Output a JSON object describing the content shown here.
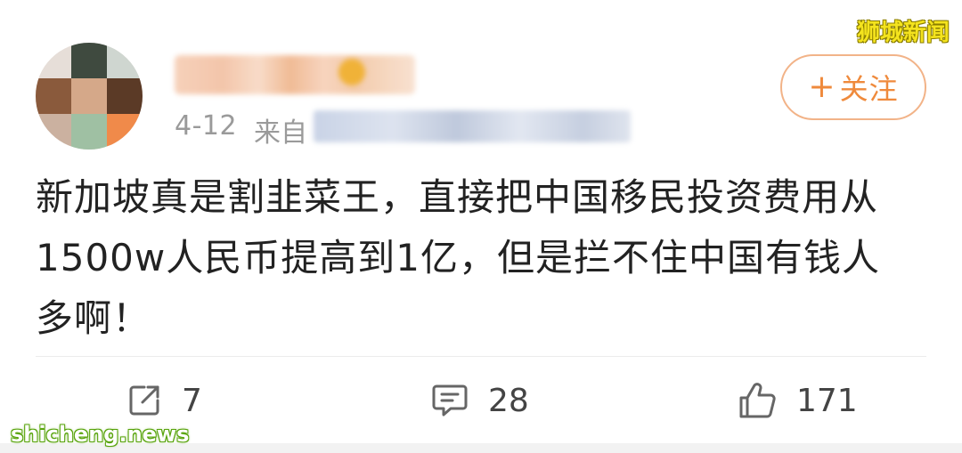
{
  "post": {
    "date": "4-12",
    "from_label": "来自",
    "follow_label": "关注",
    "text_line1": "新加坡真是割韭菜王，直接把中国移民投资费用从",
    "text_line2": "1500w人民币提高到1亿，但是拦不住中国有钱人",
    "text_line3": "多啊！"
  },
  "actions": {
    "share_count": "7",
    "comment_count": "28",
    "like_count": "171"
  },
  "watermarks": {
    "top": "狮城新闻",
    "bottom": "shicheng.news"
  },
  "colors": {
    "accent": "#ef8a3c",
    "follow_border": "#f2b388",
    "meta_text": "#9a9a9a",
    "body_text": "#222222"
  },
  "icons": {
    "share": "share-icon",
    "comment": "comment-icon",
    "like": "like-icon"
  }
}
